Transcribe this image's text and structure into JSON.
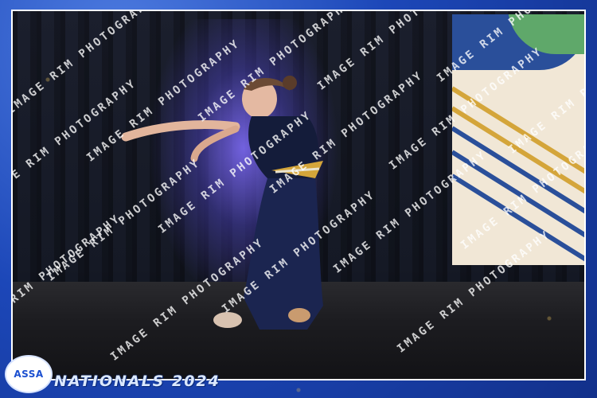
{
  "logo": {
    "text": "ASSA"
  },
  "event_title": "NATIONALS 2024",
  "watermark": {
    "text": "IMAGE RIM PHOTOGRAPHY"
  },
  "colors": {
    "frame": "#1c47b8",
    "spotlight": "#6b5cff",
    "banner_blue": "#2a4f9a",
    "banner_green": "#5fa86a",
    "banner_gold": "#d4a53a"
  }
}
